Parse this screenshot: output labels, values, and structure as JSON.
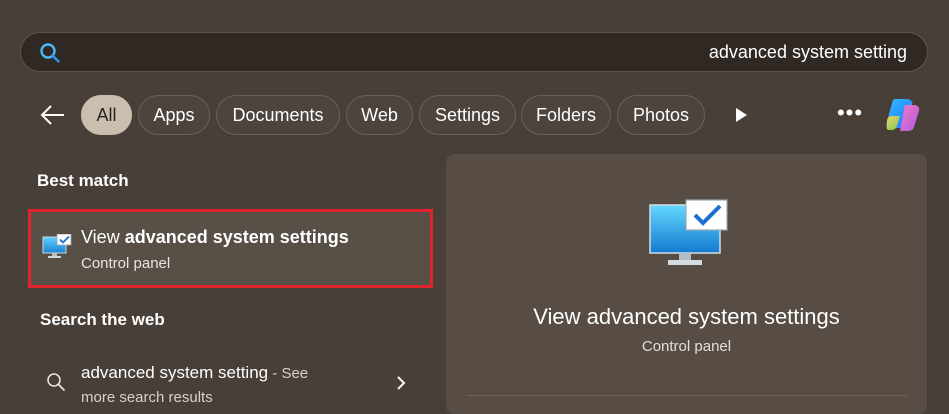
{
  "search": {
    "query": "advanced system setting",
    "icon": "search-icon"
  },
  "filters": {
    "back_icon": "arrow-left-icon",
    "chips": [
      "All",
      "Apps",
      "Documents",
      "Web",
      "Settings",
      "Folders",
      "Photos"
    ],
    "active": "All",
    "more_icon": "play-icon",
    "overflow_icon": "more-horizontal-icon",
    "copilot_icon": "copilot-icon"
  },
  "best_match": {
    "heading": "Best match",
    "title_prefix": "View ",
    "title_bold": "advanced system settings",
    "subtitle": "Control panel",
    "icon": "monitor-checkmark-icon",
    "highlight_color": "#e2222c"
  },
  "web": {
    "heading": "Search the web",
    "query": "advanced system setting",
    "see_suffix": " - See",
    "line2": "more search results",
    "icon": "search-icon"
  },
  "preview": {
    "title": "View advanced system settings",
    "subtitle": "Control panel",
    "icon": "monitor-checkmark-icon"
  },
  "colors": {
    "background": "#483f38",
    "active_chip": "#cabfae",
    "panel": "#574d45"
  }
}
